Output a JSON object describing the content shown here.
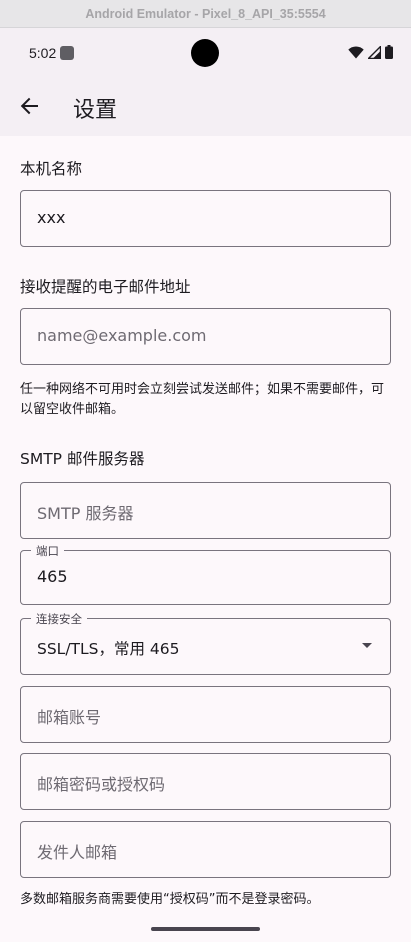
{
  "emulator": {
    "title": "Android Emulator - Pixel_8_API_35:5554"
  },
  "status_bar": {
    "time": "5:02",
    "icons": [
      "wifi-icon",
      "cell-signal-icon",
      "battery-icon"
    ]
  },
  "app_bar": {
    "title": "设置",
    "back_icon": "arrow-back-icon"
  },
  "device_name": {
    "label": "本机名称",
    "value": "xxx"
  },
  "alert_email": {
    "label": "接收提醒的电子邮件地址",
    "placeholder": "name@example.com",
    "helper": "任一种网络不可用时会立刻尝试发送邮件；如果不需要邮件，可以留空收件邮箱。"
  },
  "smtp": {
    "section_label": "SMTP 邮件服务器",
    "server_placeholder": "SMTP 服务器",
    "port_label": "端口",
    "port_value": "465",
    "security_label": "连接安全",
    "security_value": "SSL/TLS，常用 465",
    "account_placeholder": "邮箱账号",
    "password_placeholder": "邮箱密码或授权码",
    "sender_placeholder": "发件人邮箱",
    "helper": "多数邮箱服务商需要使用“授权码”而不是登录密码。"
  },
  "colors": {
    "surface": "#fdf8fb",
    "app_bar": "#f4eff4",
    "outline": "#79747e",
    "on_surface": "#1d1b20"
  }
}
